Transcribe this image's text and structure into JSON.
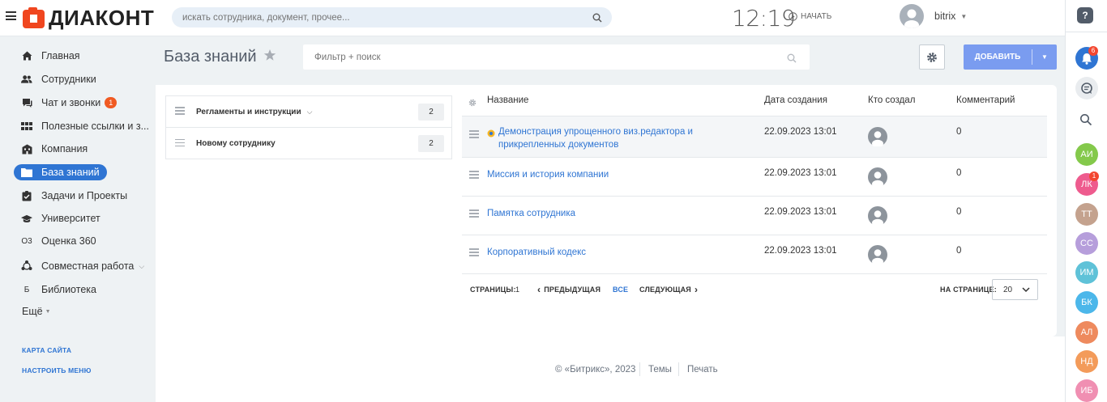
{
  "header": {
    "logo_text": "ДИАКОНТ",
    "search_placeholder": "искать сотрудника, документ, прочее...",
    "time": "12:19",
    "start_label": "НАЧАТЬ",
    "user_name": "bitrix"
  },
  "sidebar": {
    "items": [
      {
        "label": "Главная",
        "icon": "home-icon"
      },
      {
        "label": "Сотрудники",
        "icon": "people-icon"
      },
      {
        "label": "Чат и звонки",
        "icon": "chat-icon",
        "badge": "1"
      },
      {
        "label": "Полезные ссылки и з...",
        "icon": "grid-icon"
      },
      {
        "label": "Компания",
        "icon": "building-icon"
      },
      {
        "label": "База знаний",
        "icon": "folder-icon",
        "active": true
      },
      {
        "label": "Задачи и Проекты",
        "icon": "tasks-icon"
      },
      {
        "label": "Университет",
        "icon": "graduation-cap-icon"
      },
      {
        "label": "Оценка 360",
        "icon": "O3"
      },
      {
        "label": "Совместная работа",
        "icon": "collab-icon"
      },
      {
        "label": "Библиотека",
        "icon": "Б"
      },
      {
        "label": "Ещё"
      }
    ],
    "sitemap_label": "КАРТА САЙТА",
    "configure_label": "НАСТРОИТЬ МЕНЮ"
  },
  "page": {
    "title": "База знаний",
    "filter_placeholder": "Фильтр + поиск",
    "add_label": "ДОБАВИТЬ"
  },
  "sections": [
    {
      "label": "Регламенты и инструкции",
      "count": "2"
    },
    {
      "label": "Новому сотруднику",
      "count": "2"
    }
  ],
  "table": {
    "headers": {
      "name": "Название",
      "date": "Дата создания",
      "author": "Кто создал",
      "comments": "Комментарий"
    },
    "rows": [
      {
        "name": "Демонстрация упрощенного виз.редактора и прикрепленных документов",
        "date": "22.09.2023 13:01",
        "comments": "0"
      },
      {
        "name": "Миссия и история компании",
        "date": "22.09.2023 13:01",
        "comments": "0"
      },
      {
        "name": "Памятка сотрудника",
        "date": "22.09.2023 13:01",
        "comments": "0"
      },
      {
        "name": "Корпоративный кодекс",
        "date": "22.09.2023 13:01",
        "comments": "0"
      }
    ]
  },
  "pagination": {
    "pages_label": "СТРАНИЦЫ:",
    "current_page": "1",
    "prev_label": "ПРЕДЫДУЩАЯ",
    "all_label": "ВСЕ",
    "next_label": "СЛЕДУЮЩАЯ",
    "per_page_label": "НА СТРАНИЦЕ:",
    "per_page_value": "20"
  },
  "footer": {
    "copyright": "© «Битрикс», 2023",
    "themes": "Темы",
    "print": "Печать"
  },
  "right_panel": {
    "help": "?",
    "notifications_badge": "6",
    "avatars": [
      {
        "initials": "АИ",
        "color": "#84c94b"
      },
      {
        "initials": "ЛК",
        "color": "#ee5b8e",
        "badge": "1"
      },
      {
        "initials": "ТТ",
        "color": "#c4a28e"
      },
      {
        "initials": "СС",
        "color": "#b69edb"
      },
      {
        "initials": "ИМ",
        "color": "#5fc2d8"
      },
      {
        "initials": "БК",
        "color": "#4cb7ea"
      },
      {
        "initials": "АЛ",
        "color": "#ee8a5e"
      },
      {
        "initials": "НД",
        "color": "#f39b5a"
      },
      {
        "initials": "ИБ",
        "color": "#f08fb2"
      }
    ]
  }
}
